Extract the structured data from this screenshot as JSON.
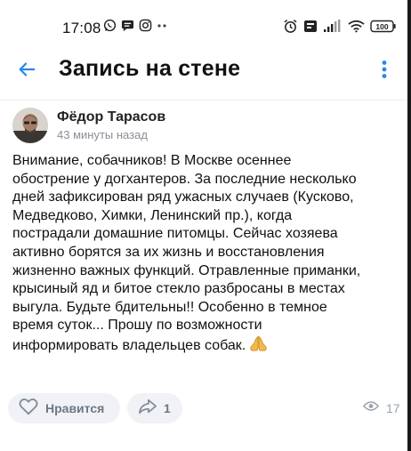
{
  "status_bar": {
    "time": "17:08",
    "left_icons": [
      "whatsapp-icon",
      "chat-bubble-icon",
      "instagram-icon",
      "more-dots-icon"
    ],
    "battery": "100"
  },
  "header": {
    "title": "Запись на стене"
  },
  "post": {
    "author": "Фёдор Тарасов",
    "time": "43 минуты назад",
    "text": "Внимание, собачников! В Москве осеннее\nобострение у догхантеров. За последние несколько\nдней зафиксирован ряд ужасных случаев (Кусково,\nМедведково, Химки, Ленинский пр.), когда\nпострадали домашние питомцы. Сейчас хозяева\nактивно борятся за их жизнь и восстановления\nжизненно важных функций. Отравленные  приманки,\nкрысиный яд и битое стекло разбросаны в местах\nвыгула. Будьте бдительны!! Особенно в темное\nвремя суток... Прошу по возможности\nинформировать владельцев собак."
  },
  "actions": {
    "like_label": "Нравится",
    "share_count": "1",
    "views_count": "17"
  },
  "colors": {
    "accent": "#2688eb",
    "secondary_text": "#6d7885",
    "pill_background": "#f0f2f5"
  }
}
